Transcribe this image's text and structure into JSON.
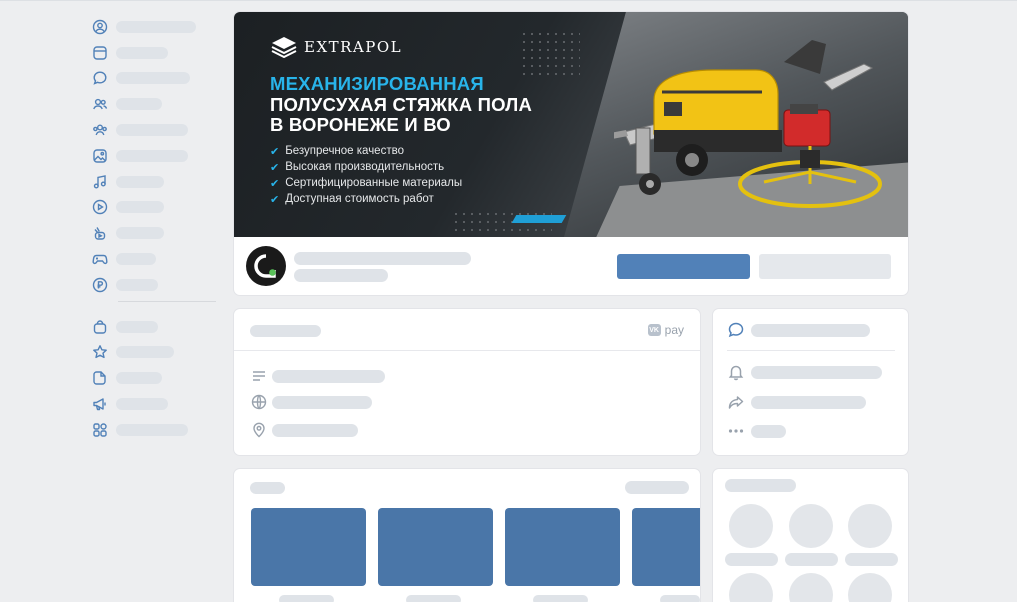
{
  "banner": {
    "brand": "EXTRAPOL",
    "headline_accent": "МЕХАНИЗИРОВАННАЯ",
    "headline_lines": [
      "ПОЛУСУХАЯ СТЯЖКА ПОЛА",
      "В ВОРОНЕЖЕ И ВО"
    ],
    "features": [
      "Безупречное качество",
      "Высокая производительность",
      "Сертифицированные материалы",
      "Доступная стоимость работ"
    ]
  },
  "info": {
    "vkpay_label": "pay",
    "vkpay_badge": "VK"
  },
  "colors": {
    "primary_button": "#5181b8",
    "banner_accent": "#28b4ea",
    "thumb": "#4a76a8",
    "skeleton": "#dfe3e8"
  },
  "nav_icons": [
    "user-circle-icon",
    "news-icon",
    "message-icon",
    "friends-icon",
    "community-icon",
    "photo-icon",
    "music-icon",
    "video-icon",
    "clips-icon",
    "games-icon",
    "ruble-icon",
    "market-icon",
    "bookmark-star-icon",
    "files-icon",
    "ads-megaphone-icon",
    "services-grid-icon"
  ]
}
